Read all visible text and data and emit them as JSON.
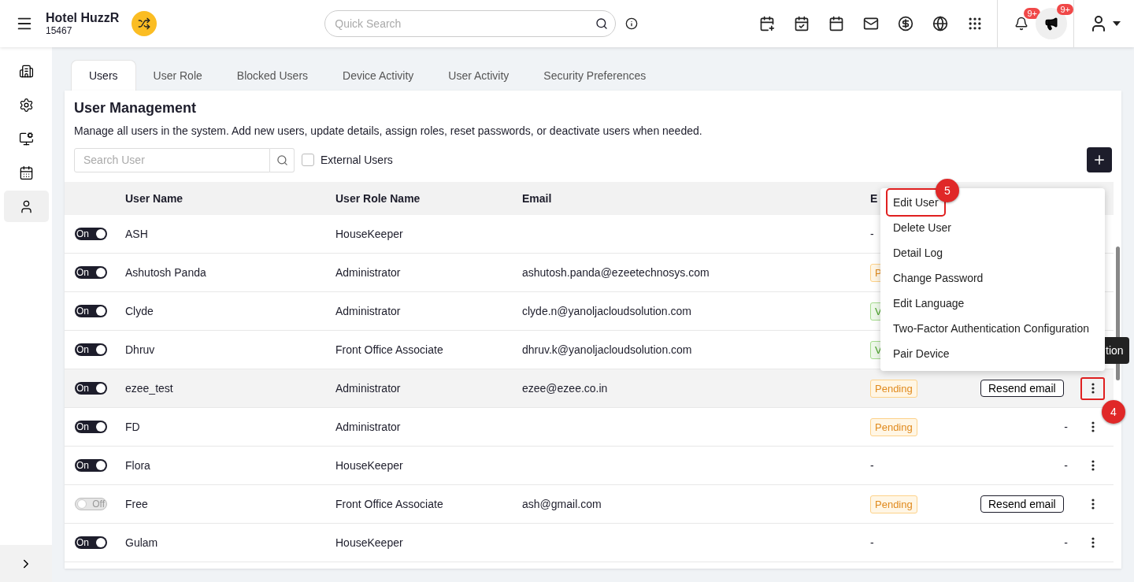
{
  "header": {
    "hotel_name": "Hotel HuzzR",
    "hotel_code": "15467",
    "search_placeholder": "Quick Search",
    "notification_badge": "9+",
    "announcement_badge": "9+"
  },
  "sidebar": {
    "items": [
      {
        "kind": "building",
        "selected": false
      },
      {
        "kind": "settings",
        "selected": false
      },
      {
        "kind": "monitor",
        "selected": false
      },
      {
        "kind": "calendar",
        "selected": false
      },
      {
        "kind": "user",
        "selected": true
      }
    ]
  },
  "tabs": [
    {
      "label": "Users",
      "selected": true
    },
    {
      "label": "User Role",
      "selected": false
    },
    {
      "label": "Blocked Users",
      "selected": false
    },
    {
      "label": "Device Activity",
      "selected": false
    },
    {
      "label": "User Activity",
      "selected": false
    },
    {
      "label": "Security Preferences",
      "selected": false
    }
  ],
  "page": {
    "title": "User Management",
    "description": "Manage all users in the system. Add new users, update details, assign roles, reset passwords, or deactivate users when needed."
  },
  "user_search": {
    "placeholder": "Search User"
  },
  "external_users": {
    "label": "External Users",
    "checked": false
  },
  "table": {
    "columns": [
      "User Name",
      "User Role Name",
      "Email",
      "E"
    ],
    "rows": [
      {
        "toggle": "On",
        "on": true,
        "name": "ASH",
        "role": "HouseKeeper",
        "email": "",
        "status": {
          "kind": "none",
          "label": "-"
        },
        "hovered": false
      },
      {
        "toggle": "On",
        "on": true,
        "name": "Ashutosh Panda",
        "role": "Administrator",
        "email": "ashutosh.panda@ezeetechnosys.com",
        "status": {
          "kind": "pending",
          "label": "P"
        },
        "hovered": false
      },
      {
        "toggle": "On",
        "on": true,
        "name": "Clyde",
        "role": "Administrator",
        "email": "clyde.n@yanoljacloudsolution.com",
        "status": {
          "kind": "verified",
          "label": "V"
        },
        "hovered": false
      },
      {
        "toggle": "On",
        "on": true,
        "name": "Dhruv",
        "role": "Front Office Associate",
        "email": "dhruv.k@yanoljacloudsolution.com",
        "status": {
          "kind": "verified",
          "label": "V"
        },
        "hovered": false
      },
      {
        "toggle": "On",
        "on": true,
        "name": "ezee_test",
        "role": "Administrator",
        "email": "ezee@ezee.co.in",
        "status": {
          "kind": "pending",
          "label": "Pending"
        },
        "resend": {
          "kind": "button",
          "label": "Resend email"
        },
        "more": {
          "highlighted": true,
          "step": "4"
        },
        "hovered": true
      },
      {
        "toggle": "On",
        "on": true,
        "name": "FD",
        "role": "Administrator",
        "email": "",
        "status": {
          "kind": "pending",
          "label": "Pending"
        },
        "resend": {
          "kind": "dash",
          "label": "-"
        },
        "more": {
          "highlighted": false
        },
        "hovered": false
      },
      {
        "toggle": "On",
        "on": true,
        "name": "Flora",
        "role": "HouseKeeper",
        "email": "",
        "status": {
          "kind": "none",
          "label": "-"
        },
        "resend": {
          "kind": "dash",
          "label": "-"
        },
        "more": {
          "highlighted": false
        },
        "hovered": false
      },
      {
        "toggle": "Off",
        "on": false,
        "name": "Free",
        "role": "Front Office Associate",
        "email": "ash@gmail.com",
        "status": {
          "kind": "pending",
          "label": "Pending"
        },
        "resend": {
          "kind": "button",
          "label": "Resend email"
        },
        "more": {
          "highlighted": false
        },
        "hovered": false
      },
      {
        "toggle": "On",
        "on": true,
        "name": "Gulam",
        "role": "HouseKeeper",
        "email": "",
        "status": {
          "kind": "none",
          "label": "-"
        },
        "resend": {
          "kind": "dash",
          "label": "-"
        },
        "more": {
          "highlighted": false
        },
        "hovered": false
      }
    ]
  },
  "menu": {
    "items": [
      {
        "label": "Edit User",
        "highlighted": true,
        "step": "5"
      },
      {
        "label": "Delete User",
        "highlighted": false
      },
      {
        "label": "Detail Log",
        "highlighted": false
      },
      {
        "label": "Change Password",
        "highlighted": false
      },
      {
        "label": "Edit Language",
        "highlighted": false
      },
      {
        "label": "Two-Factor Authentication Configuration",
        "highlighted": false
      },
      {
        "label": "Pair Device",
        "highlighted": false
      }
    ]
  },
  "tooltip": {
    "text": "tion"
  }
}
